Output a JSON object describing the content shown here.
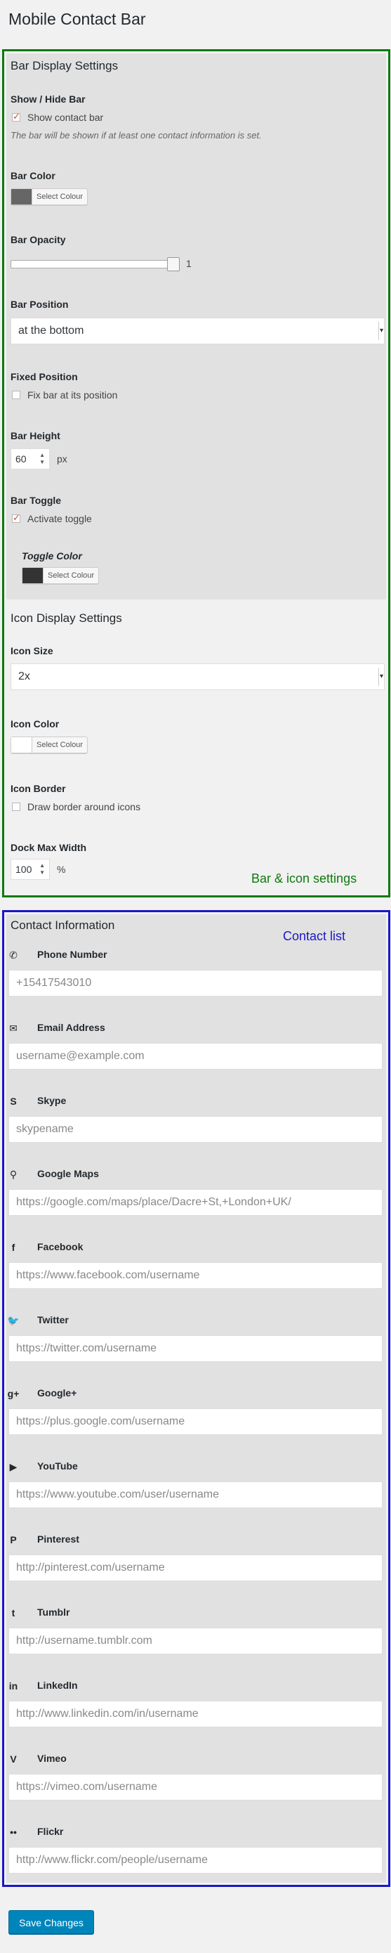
{
  "page": {
    "title": "Mobile Contact Bar"
  },
  "bar_settings": {
    "section_title": "Bar Display Settings",
    "show_hide": {
      "label": "Show / Hide Bar",
      "checkbox_label": "Show contact bar",
      "checked": true,
      "hint": "The bar will be shown if at least one contact information is set."
    },
    "bar_color": {
      "label": "Bar Color",
      "color": "#666666",
      "button": "Select Colour"
    },
    "bar_opacity": {
      "label": "Bar Opacity",
      "value": "1"
    },
    "bar_position": {
      "label": "Bar Position",
      "selected": "at the bottom"
    },
    "fixed_position": {
      "label": "Fixed Position",
      "checkbox_label": "Fix bar at its position",
      "checked": false
    },
    "bar_height": {
      "label": "Bar Height",
      "value": "60",
      "unit": "px"
    },
    "bar_toggle": {
      "label": "Bar Toggle",
      "checkbox_label": "Activate toggle",
      "checked": true
    },
    "toggle_color": {
      "label": "Toggle Color",
      "color": "#333333",
      "button": "Select Colour"
    }
  },
  "icon_settings": {
    "section_title": "Icon Display Settings",
    "icon_size": {
      "label": "Icon Size",
      "selected": "2x"
    },
    "icon_color": {
      "label": "Icon Color",
      "color": "#ffffff",
      "button": "Select Colour"
    },
    "icon_border": {
      "label": "Icon Border",
      "checkbox_label": "Draw border around icons",
      "checked": false
    },
    "dock_max_width": {
      "label": "Dock Max Width",
      "value": "100",
      "unit": "%"
    }
  },
  "annotations": {
    "green": "Bar & icon settings",
    "blue": "Contact list"
  },
  "contacts": {
    "section_title": "Contact Information",
    "items": [
      {
        "icon": "phone-icon",
        "glyph": "✆",
        "label": "Phone Number",
        "placeholder": "+15417543010"
      },
      {
        "icon": "email-icon",
        "glyph": "✉",
        "label": "Email Address",
        "placeholder": "username@example.com"
      },
      {
        "icon": "skype-icon",
        "glyph": "S",
        "label": "Skype",
        "placeholder": "skypename"
      },
      {
        "icon": "map-marker-icon",
        "glyph": "⚲",
        "label": "Google Maps",
        "placeholder": "https://google.com/maps/place/Dacre+St,+London+UK/"
      },
      {
        "icon": "facebook-icon",
        "glyph": "f",
        "label": "Facebook",
        "placeholder": "https://www.facebook.com/username"
      },
      {
        "icon": "twitter-icon",
        "glyph": "🐦",
        "label": "Twitter",
        "placeholder": "https://twitter.com/username"
      },
      {
        "icon": "google-plus-icon",
        "glyph": "g+",
        "label": "Google+",
        "placeholder": "https://plus.google.com/username"
      },
      {
        "icon": "youtube-icon",
        "glyph": "▶",
        "label": "YouTube",
        "placeholder": "https://www.youtube.com/user/username"
      },
      {
        "icon": "pinterest-icon",
        "glyph": "P",
        "label": "Pinterest",
        "placeholder": "http://pinterest.com/username"
      },
      {
        "icon": "tumblr-icon",
        "glyph": "t",
        "label": "Tumblr",
        "placeholder": "http://username.tumblr.com"
      },
      {
        "icon": "linkedin-icon",
        "glyph": "in",
        "label": "LinkedIn",
        "placeholder": "http://www.linkedin.com/in/username"
      },
      {
        "icon": "vimeo-icon",
        "glyph": "V",
        "label": "Vimeo",
        "placeholder": "https://vimeo.com/username"
      },
      {
        "icon": "flickr-icon",
        "glyph": "••",
        "label": "Flickr",
        "placeholder": "http://www.flickr.com/people/username"
      }
    ]
  },
  "footer": {
    "save_label": "Save Changes"
  }
}
